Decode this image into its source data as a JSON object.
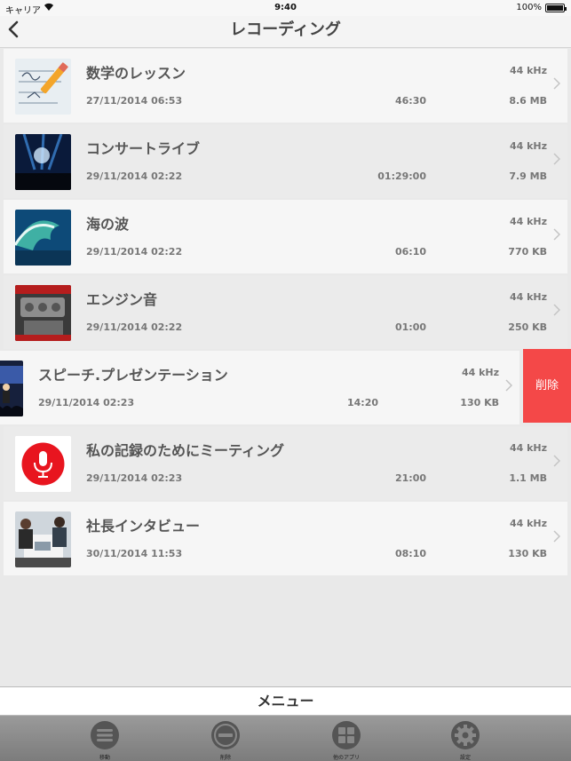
{
  "status": {
    "carrier": "キャリア",
    "time": "9:40",
    "battery": "100%"
  },
  "nav": {
    "title": "レコーディング"
  },
  "recordings": [
    {
      "name": "数学のレッスン",
      "khz": "44 kHz",
      "date": "27/11/2014 06:53",
      "duration": "46:30",
      "size": "8.6 MB",
      "thumb": "math-lesson"
    },
    {
      "name": "コンサートライブ",
      "khz": "44 kHz",
      "date": "29/11/2014 02:22",
      "duration": "01:29:00",
      "size": "7.9 MB",
      "thumb": "concert"
    },
    {
      "name": "海の波",
      "khz": "44 kHz",
      "date": "29/11/2014 02:22",
      "duration": "06:10",
      "size": "770 KB",
      "thumb": "ocean-wave"
    },
    {
      "name": "エンジン音",
      "khz": "44 kHz",
      "date": "29/11/2014 02:22",
      "duration": "01:00",
      "size": "250 KB",
      "thumb": "engine"
    },
    {
      "name": "スピーチ.プレゼンテーション",
      "khz": "44 kHz",
      "date": "29/11/2014 02:23",
      "duration": "14:20",
      "size": "130 KB",
      "thumb": "speech"
    },
    {
      "name": "私の記録のためにミーティング",
      "khz": "44 kHz",
      "date": "29/11/2014 02:23",
      "duration": "21:00",
      "size": "1.1 MB",
      "thumb": "microphone"
    },
    {
      "name": "社長インタビュー",
      "khz": "44 kHz",
      "date": "30/11/2014 11:53",
      "duration": "08:10",
      "size": "130 KB",
      "thumb": "interview"
    }
  ],
  "delete_label": "削除",
  "menu_label": "メニュー",
  "tabs": [
    {
      "label": "移動",
      "icon": "move-icon"
    },
    {
      "label": "削除",
      "icon": "minus-icon"
    },
    {
      "label": "他のアプリ",
      "icon": "apps-grid-icon"
    },
    {
      "label": "設定",
      "icon": "gear-icon"
    }
  ],
  "colors": {
    "delete": "#f44848",
    "mic": "#e8151f"
  }
}
